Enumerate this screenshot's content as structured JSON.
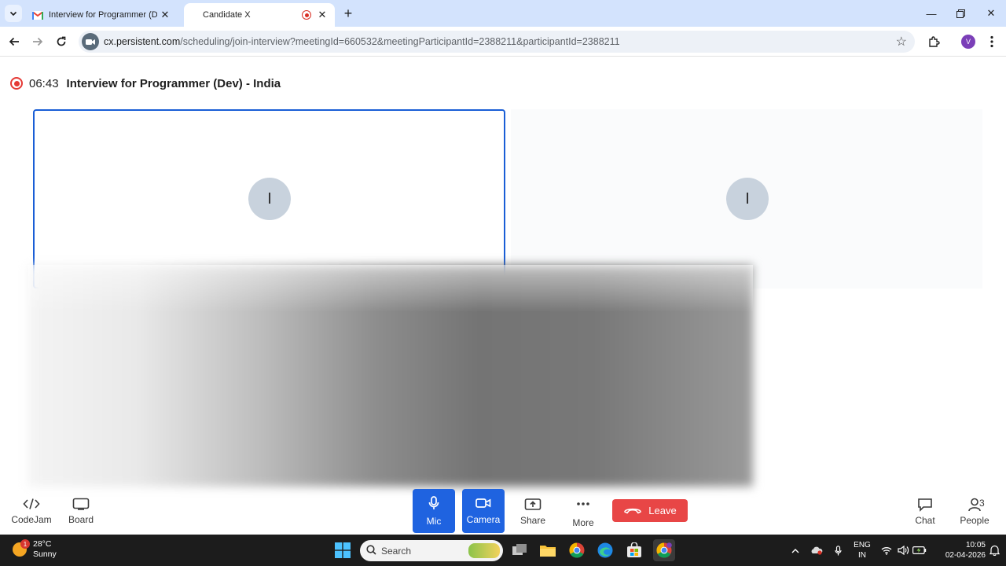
{
  "browser": {
    "tabs": [
      {
        "title": "Interview for Programmer (Dev)",
        "favicon": "gmail-icon",
        "active": false
      },
      {
        "title": "Candidate X",
        "favicon": "recording-icon",
        "active": true
      }
    ],
    "new_tab_label": "+",
    "url_domain": "cx.persistent.com",
    "url_path": "/scheduling/join-interview?meetingId=660532&meetingParticipantId=2388211&participantId=2388211",
    "profile_initial": "V"
  },
  "meeting": {
    "timer": "06:43",
    "title": "Interview for Programmer (Dev) - India",
    "participants": [
      {
        "initial": "I"
      },
      {
        "initial": "I"
      }
    ]
  },
  "controls": {
    "codejam": "CodeJam",
    "board": "Board",
    "mic": "Mic",
    "camera": "Camera",
    "share": "Share",
    "more": "More",
    "leave": "Leave",
    "chat": "Chat",
    "people": "People",
    "people_count": "3"
  },
  "taskbar": {
    "temperature": "28°C",
    "condition": "Sunny",
    "weather_badge": "1",
    "search_placeholder": "Search",
    "lang_top": "ENG",
    "lang_bottom": "IN",
    "time": "10:05",
    "date": "02-04-2026"
  },
  "colors": {
    "accent": "#1f63e0",
    "leave": "#e84646",
    "recording": "#e53935",
    "tabstrip": "#d3e3fd"
  }
}
